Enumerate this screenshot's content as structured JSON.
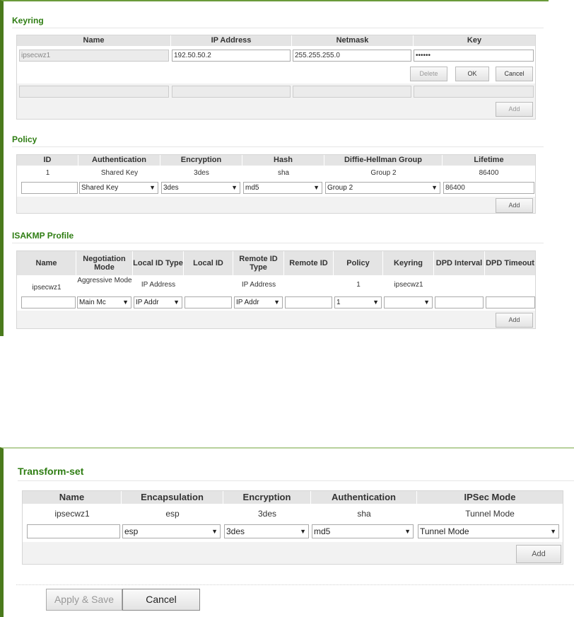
{
  "keyring": {
    "title": "Keyring",
    "headers": [
      "Name",
      "IP Address",
      "Netmask",
      "Key"
    ],
    "row": {
      "name": "ipsecwz1",
      "ip": "192.50.50.2",
      "netmask": "255.255.255.0",
      "key": "••••••"
    },
    "delete_label": "Delete",
    "ok_label": "OK",
    "cancel_label": "Cancel",
    "add_label": "Add"
  },
  "policy": {
    "title": "Policy",
    "headers": [
      "ID",
      "Authentication",
      "Encryption",
      "Hash",
      "Diffie-Hellman Group",
      "Lifetime"
    ],
    "row": [
      "1",
      "Shared Key",
      "3des",
      "sha",
      "Group 2",
      "86400"
    ],
    "edit": {
      "id": "",
      "authentication": "Shared Key",
      "encryption": "3des",
      "hash": "md5",
      "dh_group": "Group 2",
      "lifetime": "86400"
    },
    "add_label": "Add"
  },
  "isakmp": {
    "title": "ISAKMP Profile",
    "headers": [
      "Name",
      "Negotiation Mode",
      "Local ID Type",
      "Local ID",
      "Remote ID Type",
      "Remote ID",
      "Policy",
      "Keyring",
      "DPD Interval",
      "DPD Timeout"
    ],
    "row": [
      "ipsecwz1",
      "Aggressive Mode",
      "IP Address",
      "",
      "IP Address",
      "",
      "1",
      "ipsecwz1",
      "",
      ""
    ],
    "edit": {
      "negotiation_mode": "Main Mc",
      "local_id_type": "IP Addr",
      "remote_id_type": "IP Addr",
      "policy": "1",
      "keyring": ""
    },
    "add_label": "Add"
  },
  "transform": {
    "title": "Transform-set",
    "headers": [
      "Name",
      "Encapsulation",
      "Encryption",
      "Authentication",
      "IPSec Mode"
    ],
    "row": [
      "ipsecwz1",
      "esp",
      "3des",
      "sha",
      "Tunnel Mode"
    ],
    "edit": {
      "name": "",
      "encapsulation": "esp",
      "encryption": "3des",
      "authentication": "md5",
      "ipsec_mode": "Tunnel Mode"
    },
    "add_label": "Add"
  },
  "footer": {
    "apply_label": "Apply & Save",
    "cancel_label": "Cancel"
  },
  "icons": {
    "dropdown": "triangle-down-icon"
  },
  "colors": {
    "section_title": "#2e7d12",
    "frame": "#4a7a1c"
  }
}
